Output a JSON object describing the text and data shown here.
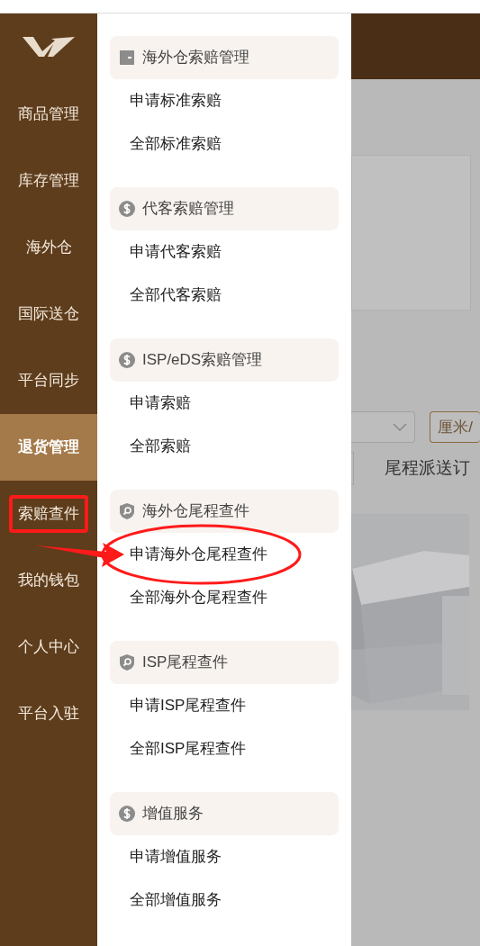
{
  "sidebar": {
    "items": [
      {
        "label": "商品管理",
        "selected": false,
        "highlighted": false
      },
      {
        "label": "库存管理",
        "selected": false,
        "highlighted": false
      },
      {
        "label": "海外仓",
        "selected": false,
        "highlighted": false
      },
      {
        "label": "国际送仓",
        "selected": false,
        "highlighted": false
      },
      {
        "label": "平台同步",
        "selected": false,
        "highlighted": false
      },
      {
        "label": "退货管理",
        "selected": true,
        "highlighted": false
      },
      {
        "label": "索赔查件",
        "selected": false,
        "highlighted": true
      },
      {
        "label": "我的钱包",
        "selected": false,
        "highlighted": false
      },
      {
        "label": "个人中心",
        "selected": false,
        "highlighted": false
      },
      {
        "label": "平台入驻",
        "selected": false,
        "highlighted": false
      }
    ]
  },
  "arrow": true,
  "submenu": {
    "groups": [
      {
        "title": "海外仓索赔管理",
        "kind": "card",
        "items": [
          {
            "label": "申请标准索赔",
            "circled": false
          },
          {
            "label": "全部标准索赔",
            "circled": false
          }
        ]
      },
      {
        "title": "代客索赔管理",
        "kind": "dollar",
        "items": [
          {
            "label": "申请代客索赔",
            "circled": false
          },
          {
            "label": "全部代客索赔",
            "circled": false
          }
        ]
      },
      {
        "title": "ISP/eDS索赔管理",
        "kind": "dollar",
        "items": [
          {
            "label": "申请索赔",
            "circled": false
          },
          {
            "label": "全部索赔",
            "circled": false
          }
        ]
      },
      {
        "title": "海外仓尾程查件",
        "kind": "shield",
        "items": [
          {
            "label": "申请海外仓尾程查件",
            "circled": true
          },
          {
            "label": "全部海外仓尾程查件",
            "circled": false
          }
        ]
      },
      {
        "title": "ISP尾程查件",
        "kind": "shield",
        "items": [
          {
            "label": "申请ISP尾程查件",
            "circled": false
          },
          {
            "label": "全部ISP尾程查件",
            "circled": false
          }
        ]
      },
      {
        "title": "增值服务",
        "kind": "dollar",
        "items": [
          {
            "label": "申请增值服务",
            "circled": false
          },
          {
            "label": "全部增值服务",
            "circled": false
          }
        ]
      }
    ]
  },
  "background": {
    "unit_button": "厘米/",
    "section_title": "尾程派送订"
  }
}
